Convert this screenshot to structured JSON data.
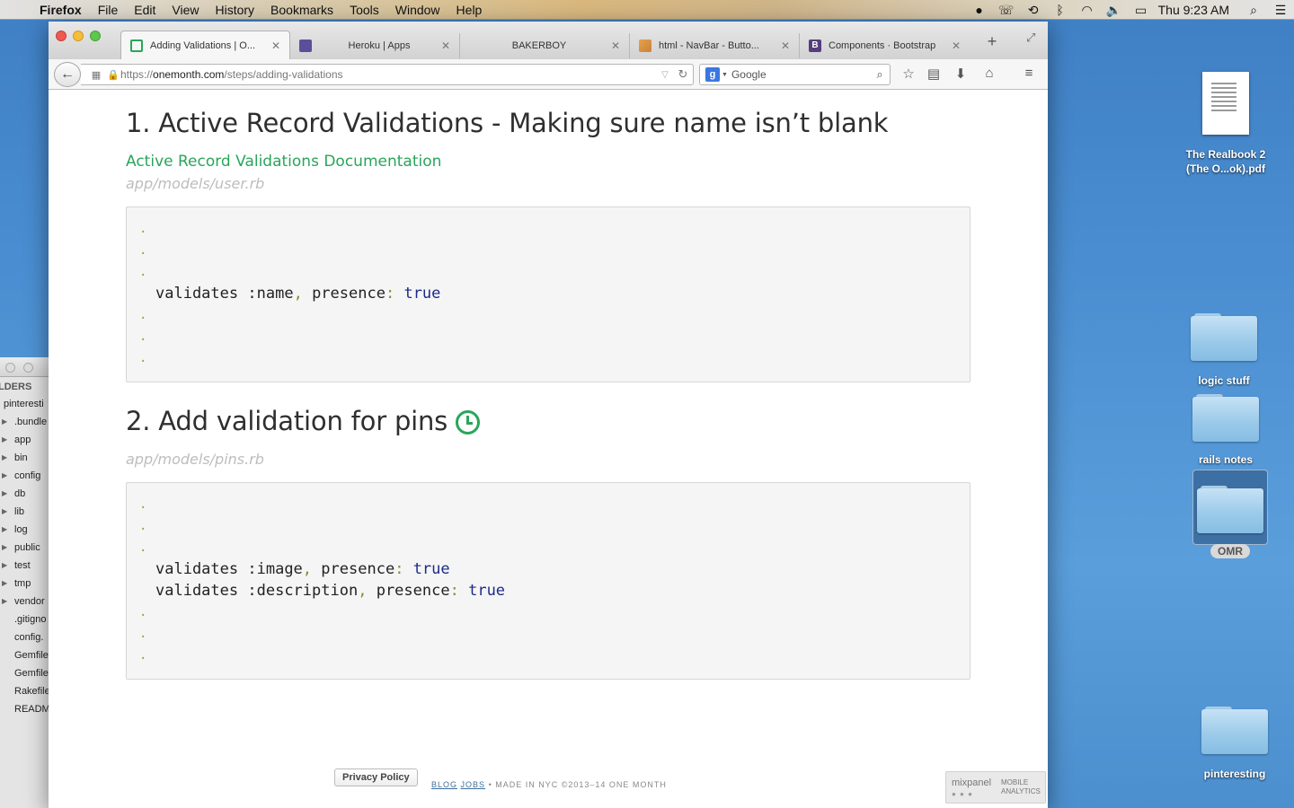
{
  "menubar": {
    "app": "Firefox",
    "items": [
      "File",
      "Edit",
      "View",
      "History",
      "Bookmarks",
      "Tools",
      "Window",
      "Help"
    ],
    "clock": "Thu 9:23 AM"
  },
  "desktop": {
    "pdf_label_1": "The Realbook 2",
    "pdf_label_2": "(The O...ok).pdf",
    "folder_logic": "logic stuff",
    "folder_rails": "rails notes",
    "folder_omr": "OMR",
    "folder_pinteresting": "pinteresting"
  },
  "editor": {
    "header": "LDERS",
    "items": [
      "pinteresti",
      ".bundle",
      "app",
      "bin",
      "config",
      "db",
      "lib",
      "log",
      "public",
      "test",
      "tmp",
      "vendor",
      ".gitigno",
      "config.",
      "Gemfile",
      "Gemfile",
      "Rakefile",
      "READM"
    ]
  },
  "browser": {
    "tabs": [
      {
        "title": "Adding Validations | O...",
        "favicon_color": "#2aa55a"
      },
      {
        "title": "Heroku | Apps",
        "favicon_color": "#5a4f9a"
      },
      {
        "title": "BAKERBOY",
        "favicon_color": ""
      },
      {
        "title": "html - NavBar - Butto...",
        "favicon_color": "#e8a04a"
      },
      {
        "title": "Components · Bootstrap",
        "favicon_color": "#563d7c"
      }
    ],
    "url_prefix": "https://",
    "url_host": "onemonth.com",
    "url_path": "/steps/adding-validations",
    "search_engine": "Google"
  },
  "page": {
    "step1_title": "1. Active Record Validations - Making sure name isn’t blank",
    "doc_link": "Active Record Validations Documentation",
    "file1": "app/models/user.rb",
    "code1": {
      "dot": ".",
      "validates": "validates",
      "sym": ":name",
      "comma": ",",
      "presence": "presence",
      "colon": ":",
      "value": "true"
    },
    "step2_title": "2. Add validation for pins",
    "file2": "app/models/pins.rb",
    "code2": {
      "dot": ".",
      "validates": "validates",
      "sym1": ":image",
      "sym2": ":description",
      "comma": ",",
      "presence": "presence",
      "colon": ":",
      "value": "true"
    },
    "footer": {
      "privacy": "Privacy Policy",
      "blog": "BLOG",
      "jobs": "JOBS",
      "made": "• MADE IN NYC ©2013–14 ONE MONTH"
    },
    "mixpanel": {
      "name": "mixpanel",
      "sub1": "MOBILE",
      "sub2": "ANALYTICS"
    }
  }
}
